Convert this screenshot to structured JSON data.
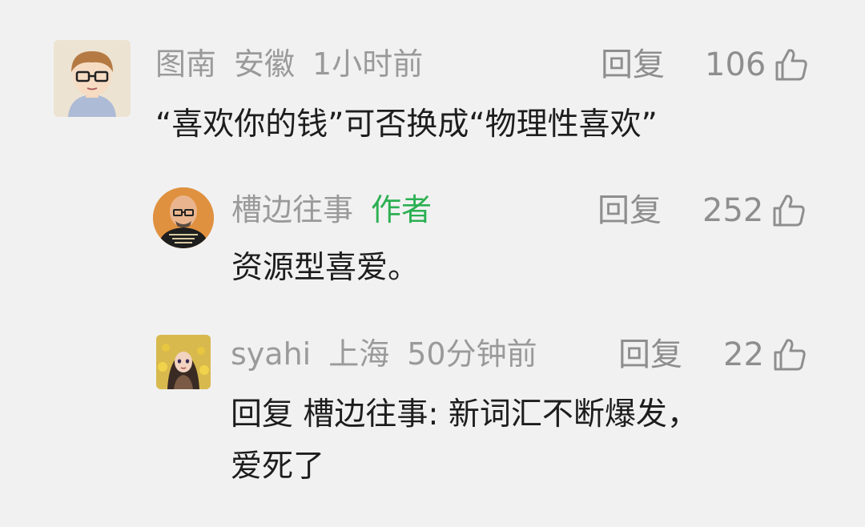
{
  "comments": [
    {
      "user": "图南",
      "location": "安徽",
      "time": "1小时前",
      "reply_label": "回复",
      "likes": "106",
      "text": "“喜欢你的钱”可否换成“物理性喜欢”"
    },
    {
      "user": "槽边往事",
      "author_tag": "作者",
      "reply_label": "回复",
      "likes": "252",
      "text": "资源型喜爱。"
    },
    {
      "user": "syahi",
      "location": "上海",
      "time": "50分钟前",
      "reply_label": "回复",
      "likes": "22",
      "text_line1": "回复 槽边往事: 新词汇不断爆发，",
      "text_line2": "爱死了"
    }
  ],
  "colors": {
    "background": "#f1f1f1",
    "meta_text": "#9a9a9a",
    "author_tag": "#2bb052",
    "body_text": "#1d1d1d"
  },
  "icons": {
    "like": "thumbs-up-icon",
    "avatar_1": "cartoon-boy-glasses-avatar",
    "avatar_2": "bald-man-glasses-avatar",
    "avatar_3": "anime-girl-flowers-avatar"
  }
}
